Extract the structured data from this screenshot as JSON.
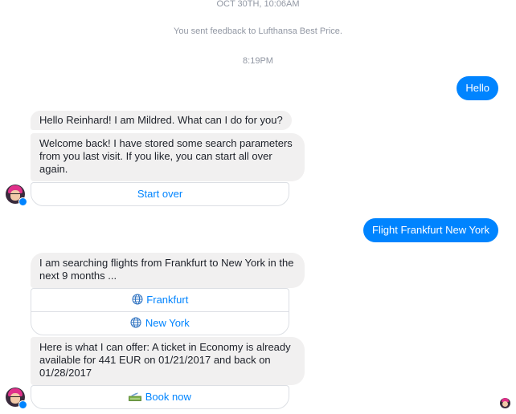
{
  "timestamps": {
    "top": "OCT 30TH, 10:06AM",
    "middle": "8:19PM"
  },
  "feedback_notice": "You sent feedback to Lufthansa Best Price.",
  "messages": {
    "user_hello": "Hello",
    "bot_greeting": "Hello Reinhard! I am Mildred. What can I do for you?",
    "bot_welcome_line1": "Welcome back! I have stored some search parameters",
    "bot_welcome_line2": "from you last visit. If you like, you can start all over",
    "bot_welcome_line3": "again.",
    "user_flight": "Flight Frankfurt New York",
    "bot_search_line1": "I am searching flights from Frankfurt to New York in the",
    "bot_search_line2": "next 9 months ...",
    "bot_offer_line1": "Here is what I can offer: A ticket in Economy is already",
    "bot_offer_line2": "available for 441 EUR on 01/21/2017 and back on",
    "bot_offer_line3": "01/28/2017"
  },
  "buttons": {
    "start_over": "Start over",
    "frankfurt": "Frankfurt",
    "new_york": "New York",
    "book_now": "Book now"
  },
  "icons": {
    "globe": "globe-icon",
    "plane": "airplane-ticket-icon",
    "avatar": "bot-avatar",
    "read_receipt": "read-receipt-avatar"
  },
  "colors": {
    "outgoing": "#0084ff",
    "incoming": "#f1f0f0",
    "link": "#0084ff"
  }
}
